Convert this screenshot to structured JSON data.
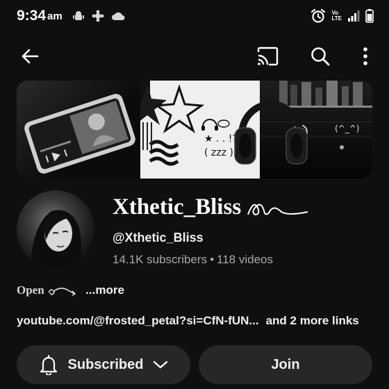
{
  "status_bar": {
    "time": "9:34",
    "ampm": "am",
    "network": "LTE",
    "volte": "Vo"
  },
  "app_bar": {
    "icons": [
      "back-arrow-icon",
      "cast-icon",
      "search-icon",
      "more-vert-icon"
    ]
  },
  "banner": {
    "caption_dots": "★ . . !?",
    "caption_zzz": "( zzz )",
    "caption_face": "(^_^)"
  },
  "channel": {
    "title": "Xthetic_Bliss",
    "handle": "@Xthetic_Bliss",
    "subscribers": "14.1K subscribers",
    "stats_separator": "•",
    "videos": "118 videos"
  },
  "description": {
    "text": "Open",
    "more_label": "...more"
  },
  "links": {
    "url": "youtube.com/@frosted_petal?si=CfN-fUN...",
    "extra": "and 2 more links"
  },
  "actions": {
    "subscribed_label": "Subscribed",
    "join_label": "Join"
  },
  "colors": {
    "background": "#0f0f0f",
    "button_bg": "#272727",
    "secondary_text": "#aaaaaa"
  }
}
